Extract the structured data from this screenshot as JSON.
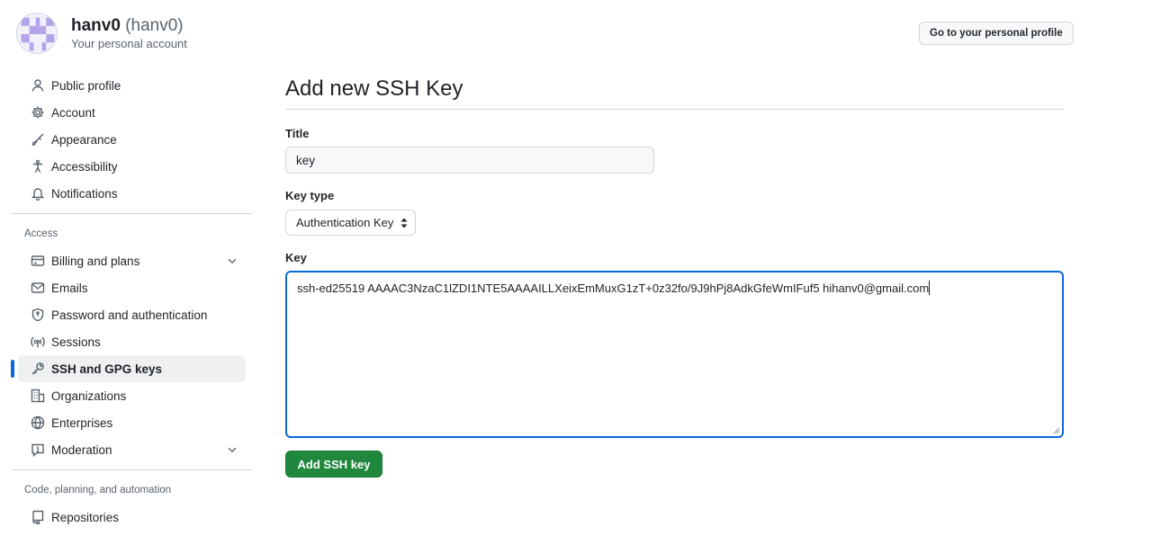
{
  "header": {
    "display_name": "hanv0",
    "login": "(hanv0)",
    "subtitle": "Your personal account",
    "profile_button": "Go to your personal profile"
  },
  "sidebar": {
    "items": [
      {
        "label": "Public profile",
        "icon": "person-icon"
      },
      {
        "label": "Account",
        "icon": "gear-icon"
      },
      {
        "label": "Appearance",
        "icon": "paintbrush-icon"
      },
      {
        "label": "Accessibility",
        "icon": "accessibility-icon"
      },
      {
        "label": "Notifications",
        "icon": "bell-icon"
      }
    ],
    "access_title": "Access",
    "access_items": [
      {
        "label": "Billing and plans",
        "icon": "credit-card-icon",
        "expandable": true
      },
      {
        "label": "Emails",
        "icon": "mail-icon"
      },
      {
        "label": "Password and authentication",
        "icon": "shield-lock-icon"
      },
      {
        "label": "Sessions",
        "icon": "broadcast-icon"
      },
      {
        "label": "SSH and GPG keys",
        "icon": "key-icon",
        "active": true
      },
      {
        "label": "Organizations",
        "icon": "organization-icon"
      },
      {
        "label": "Enterprises",
        "icon": "globe-icon"
      },
      {
        "label": "Moderation",
        "icon": "report-icon",
        "expandable": true
      }
    ],
    "code_title": "Code, planning, and automation",
    "code_items": [
      {
        "label": "Repositories",
        "icon": "repo-icon"
      }
    ]
  },
  "main": {
    "heading": "Add new SSH Key",
    "title_label": "Title",
    "title_value": "key",
    "key_type_label": "Key type",
    "key_type_value": "Authentication Key",
    "key_label": "Key",
    "key_value": "ssh-ed25519 AAAAC3NzaC1lZDI1NTE5AAAAILLXeixEmMuxG1zT+0z32fo/9J9hPj8AdkGfeWmIFuf5 hihanv0@gmail.com",
    "submit_button": "Add SSH key"
  },
  "colors": {
    "accent": "#0969da",
    "primary_button": "#1f883d",
    "muted_text": "#59636e",
    "border": "#d0d7de"
  }
}
